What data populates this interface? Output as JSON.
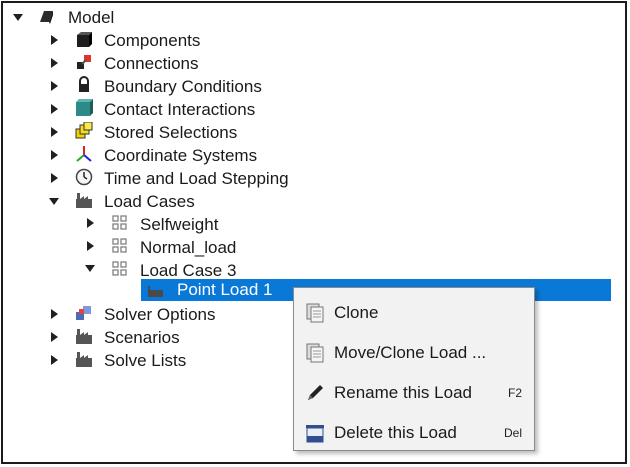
{
  "tree": {
    "root": {
      "label": "Model",
      "icon": "model-icon",
      "expanded": true
    },
    "items": [
      {
        "label": "Components",
        "icon": "components-icon"
      },
      {
        "label": "Connections",
        "icon": "connections-icon"
      },
      {
        "label": "Boundary Conditions",
        "icon": "lock-icon"
      },
      {
        "label": "Contact Interactions",
        "icon": "contact-icon"
      },
      {
        "label": "Stored Selections",
        "icon": "stored-selections-icon"
      },
      {
        "label": "Coordinate Systems",
        "icon": "axes-icon"
      },
      {
        "label": "Time and Load Stepping",
        "icon": "clock-icon"
      },
      {
        "label": "Load Cases",
        "icon": "factory-icon",
        "expanded": true
      },
      {
        "label": "Selfweight",
        "icon": "grid-icon"
      },
      {
        "label": "Normal_load",
        "icon": "grid-icon"
      },
      {
        "label": "Load Case 3",
        "icon": "grid-icon",
        "expanded": true
      },
      {
        "label": "Point Load 1",
        "icon": "load-icon",
        "selected": true
      },
      {
        "label": "Solver Options",
        "icon": "solver-icon"
      },
      {
        "label": "Scenarios",
        "icon": "factory-icon"
      },
      {
        "label": "Solve Lists",
        "icon": "factory-icon"
      }
    ]
  },
  "context_menu": {
    "items": [
      {
        "label": "Clone",
        "icon": "clone-icon",
        "shortcut": ""
      },
      {
        "label": "Move/Clone Load ...",
        "icon": "clone-icon",
        "shortcut": ""
      },
      {
        "label": "Rename this Load",
        "icon": "pencil-icon",
        "shortcut": "F2"
      },
      {
        "label": "Delete this Load",
        "icon": "trash-icon",
        "shortcut": "Del"
      }
    ]
  },
  "colors": {
    "selection": "#0a78d7",
    "menu_bg": "#f2f2f2"
  }
}
